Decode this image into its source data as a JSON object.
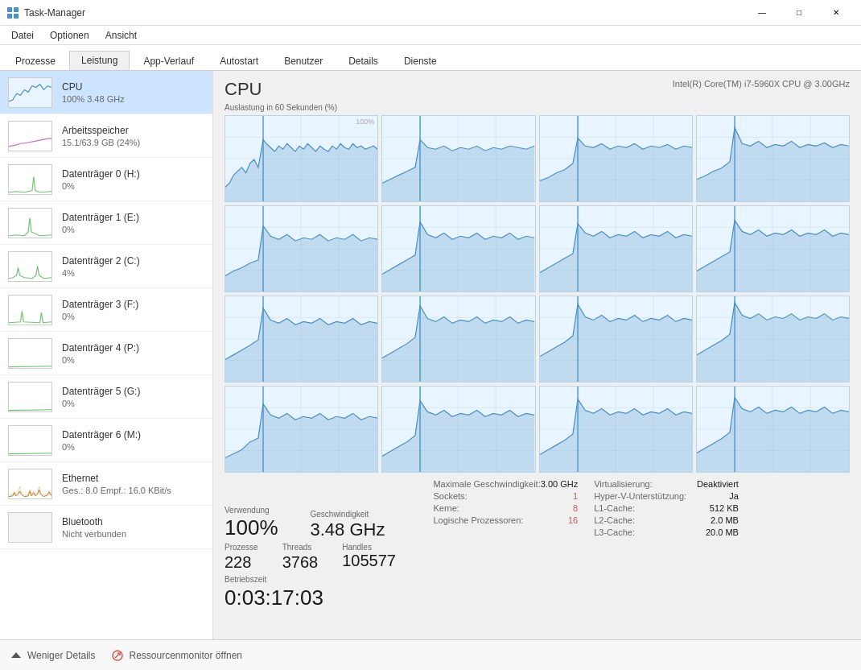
{
  "titlebar": {
    "title": "Task-Manager",
    "minimize_label": "—",
    "maximize_label": "□",
    "close_label": "✕"
  },
  "menubar": {
    "items": [
      "Datei",
      "Optionen",
      "Ansicht"
    ]
  },
  "tabs": {
    "items": [
      "Prozesse",
      "Leistung",
      "App-Verlauf",
      "Autostart",
      "Benutzer",
      "Details",
      "Dienste"
    ],
    "active": "Leistung"
  },
  "sidebar": {
    "items": [
      {
        "id": "cpu",
        "name": "CPU",
        "value": "100% 3.48 GHz",
        "active": true
      },
      {
        "id": "ram",
        "name": "Arbeitsspeicher",
        "value": "15.1/63.9 GB (24%)"
      },
      {
        "id": "disk0",
        "name": "Datenträger 0 (H:)",
        "value": "0%"
      },
      {
        "id": "disk1",
        "name": "Datenträger 1 (E:)",
        "value": "0%"
      },
      {
        "id": "disk2",
        "name": "Datenträger 2 (C:)",
        "value": "4%"
      },
      {
        "id": "disk3",
        "name": "Datenträger 3 (F:)",
        "value": "0%"
      },
      {
        "id": "disk4",
        "name": "Datenträger 4 (P:)",
        "value": "0%"
      },
      {
        "id": "disk5",
        "name": "Datenträger 5 (G:)",
        "value": "0%"
      },
      {
        "id": "disk6",
        "name": "Datenträger 6 (M:)",
        "value": "0%"
      },
      {
        "id": "eth",
        "name": "Ethernet",
        "value": "Ges.: 8.0 Empf.: 16.0 KBit/s"
      },
      {
        "id": "bt",
        "name": "Bluetooth",
        "value": "Nicht verbunden"
      }
    ]
  },
  "cpu": {
    "title": "CPU",
    "model": "Intel(R) Core(TM) i7-5960X CPU @ 3.00GHz",
    "chart_label": "Auslastung in 60 Sekunden (%)",
    "chart_percent": "100%",
    "usage_label": "Verwendung",
    "usage_value": "100%",
    "speed_label": "Geschwindigkeit",
    "speed_value": "3.48 GHz",
    "procs_label": "Prozesse",
    "procs_value": "228",
    "threads_label": "Threads",
    "threads_value": "3768",
    "handles_label": "Handles",
    "handles_value": "105577",
    "uptime_label": "Betriebszeit",
    "uptime_value": "0:03:17:03",
    "info": {
      "max_speed_label": "Maximale Geschwindigkeit:",
      "max_speed_val": "3.00 GHz",
      "sockets_label": "Sockets:",
      "sockets_val": "1",
      "cores_label": "Kerne:",
      "cores_val": "8",
      "logical_label": "Logische Prozessoren:",
      "logical_val": "16",
      "virt_label": "Virtualisierung:",
      "virt_val": "Deaktiviert",
      "hyper_label": "Hyper-V-Unterstützung:",
      "hyper_val": "Ja",
      "l1_label": "L1-Cache:",
      "l1_val": "512 KB",
      "l2_label": "L2-Cache:",
      "l2_val": "2.0 MB",
      "l3_label": "L3-Cache:",
      "l3_val": "20.0 MB"
    }
  },
  "bottombar": {
    "less_details": "Weniger Details",
    "resource_monitor": "Ressourcenmonitor öffnen"
  }
}
